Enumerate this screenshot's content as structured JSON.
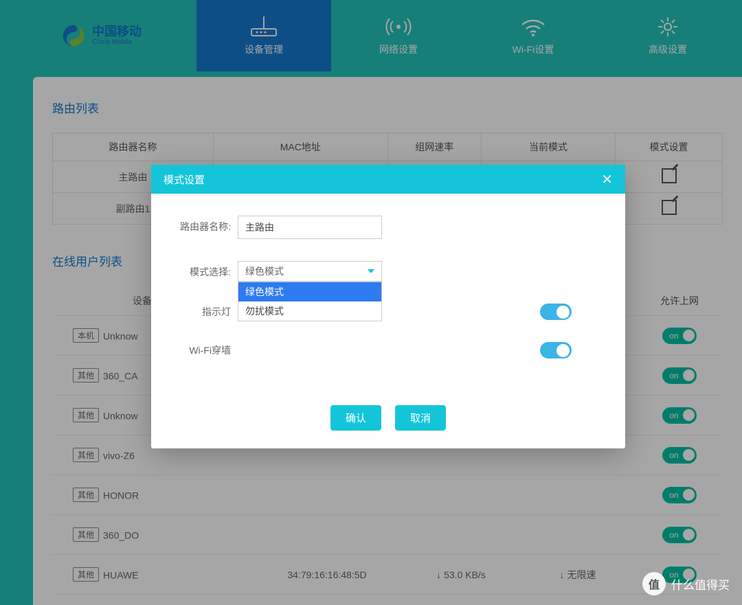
{
  "brand": {
    "name": "中国移动",
    "sub": "China Mobile"
  },
  "nav": {
    "items": [
      {
        "label": "设备管理",
        "active": true
      },
      {
        "label": "网络设置",
        "active": false
      },
      {
        "label": "Wi-Fi设置",
        "active": false
      },
      {
        "label": "高级设置",
        "active": false
      }
    ]
  },
  "router_list": {
    "title": "路由列表",
    "headers": [
      "路由器名称",
      "MAC地址",
      "组网速率",
      "当前模式",
      "模式设置"
    ],
    "rows": [
      {
        "name": "主路由"
      },
      {
        "name": "副路由1"
      }
    ]
  },
  "device_list": {
    "title": "在线用户列表",
    "headers": {
      "name": "设备名称",
      "allow": "允许上网"
    },
    "rows": [
      {
        "tag": "本机",
        "name": "Unknow",
        "on_label": "on"
      },
      {
        "tag": "其他",
        "name": "360_CA",
        "on_label": "on"
      },
      {
        "tag": "其他",
        "name": "Unknow",
        "on_label": "on"
      },
      {
        "tag": "其他",
        "name": "vivo-Z6",
        "on_label": "on"
      },
      {
        "tag": "其他",
        "name": "HONOR",
        "on_label": "on"
      },
      {
        "tag": "其他",
        "name": "360_DO",
        "on_label": "on"
      },
      {
        "tag": "其他",
        "name": "HUAWE",
        "mac": "34:79:16:16:48:5D",
        "speed": "↓ 53.0 KB/s",
        "limit": "↓ 无限速",
        "on_label": "on"
      }
    ]
  },
  "modal": {
    "title": "模式设置",
    "labels": {
      "router_name": "路由器名称:",
      "mode_select": "模式选择:",
      "indicator": "指示灯",
      "wifi_wall": "Wi-Fi穿墙"
    },
    "router_name_value": "主路由",
    "mode_selected": "绿色模式",
    "mode_options": [
      "绿色模式",
      "勿扰模式"
    ],
    "buttons": {
      "ok": "确认",
      "cancel": "取消"
    }
  },
  "watermark": "什么值得买"
}
